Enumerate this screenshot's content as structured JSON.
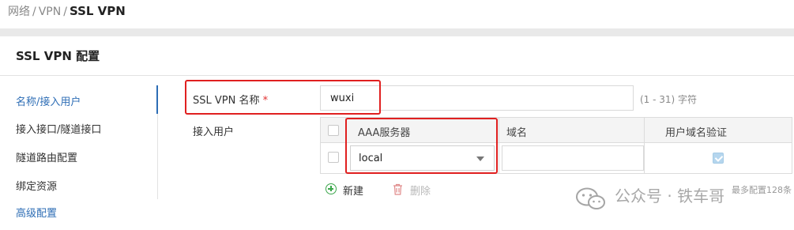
{
  "breadcrumb": {
    "items": [
      "网络",
      "VPN"
    ],
    "sep": "/",
    "current": "SSL VPN"
  },
  "panel": {
    "title": "SSL VPN 配置"
  },
  "sidenav": {
    "items": [
      {
        "label": "名称/接入用户"
      },
      {
        "label": "接入接口/隧道接口"
      },
      {
        "label": "隧道路由配置"
      },
      {
        "label": "绑定资源"
      },
      {
        "label": "高级配置"
      }
    ]
  },
  "form": {
    "name_label": "SSL VPN 名称",
    "required_mark": "*",
    "name_value": "wuxi",
    "name_hint": "(1 - 31) 字符",
    "users_label": "接入用户"
  },
  "table": {
    "columns": [
      "AAA服务器",
      "域名",
      "用户域名验证"
    ],
    "rows": [
      {
        "aaa_server": "local",
        "domain": "",
        "domain_verify": true
      }
    ],
    "add_label": "新建",
    "delete_label": "删除",
    "max_note": "最多配置128条"
  },
  "watermark": {
    "text": "公众号 · 铁车哥"
  },
  "colors": {
    "accent": "#2d6db5",
    "highlight": "#e02020",
    "add_green": "#3aa64a",
    "delete_red": "#e08a8a"
  },
  "icons": {
    "add": "add-circle-icon",
    "delete": "trash-icon",
    "dropdown": "chevron-down-icon",
    "watermark": "wechat-icon"
  }
}
